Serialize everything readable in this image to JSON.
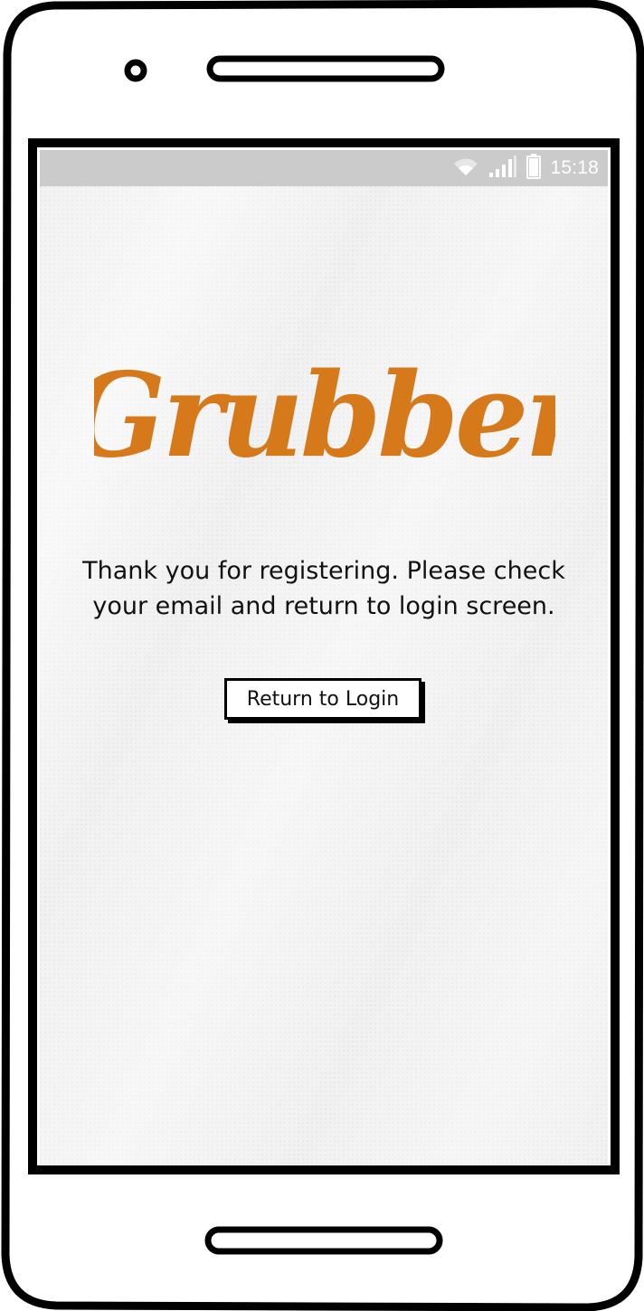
{
  "status_bar": {
    "time": "15:18",
    "wifi_icon": "wifi-icon",
    "signal_icon": "cell-signal-icon",
    "battery_icon": "battery-icon",
    "background_color": "#cbcbcb"
  },
  "brand": {
    "logo_text": "Grubber",
    "logo_color": "#d6791a"
  },
  "main": {
    "message": "Thank you for registering. Please check your email and return to login screen.",
    "return_button_label": "Return to Login"
  }
}
